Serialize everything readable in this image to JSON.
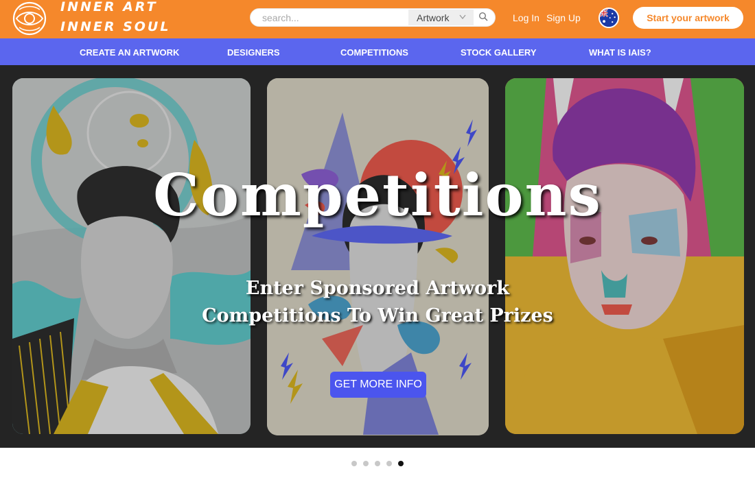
{
  "header": {
    "logo_line1": "INNER ART",
    "logo_line2": "INNER SOUL",
    "search": {
      "placeholder": "search...",
      "category": "Artwork"
    },
    "login": "Log In",
    "signup": "Sign Up",
    "flag_icon": "australia-flag-icon",
    "cta": "Start your artwork",
    "brand_color": "#f5882b"
  },
  "nav": {
    "items": [
      "CREATE AN ARTWORK",
      "DESIGNERS",
      "COMPETITIONS",
      "STOCK GALLERY",
      "WHAT IS IAIS?"
    ],
    "color": "#5b66ee"
  },
  "hero": {
    "title": "Competitions",
    "subtitle_line1": "Enter Sponsored Artwork",
    "subtitle_line2": "Competitions To Win Great Prizes",
    "button": "GET MORE INFO",
    "button_color": "#4b55ee"
  },
  "carousel": {
    "slide_count": 5,
    "active_index": 4
  }
}
